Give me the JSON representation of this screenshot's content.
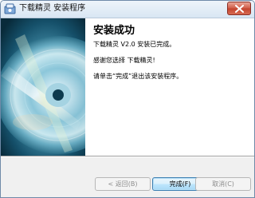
{
  "window": {
    "title": "下载精灵 安装程序",
    "icons": {
      "app": "installer-app-icon",
      "close": "close-icon"
    }
  },
  "main": {
    "heading": "安装成功",
    "lines": [
      "下载精灵 V2.0 安装已完成。",
      "感谢您选择 下载精灵!",
      "请单击“完成”退出该安装程序。"
    ]
  },
  "buttons": {
    "back": {
      "label": "< 返回(B)",
      "enabled": false
    },
    "finish": {
      "label": "完成(F)",
      "enabled": true
    },
    "cancel": {
      "label": "取消(C)",
      "enabled": false
    }
  },
  "colors": {
    "title_gradient_top": "#eef4fa",
    "close_red": "#c2422c",
    "cd_panel_bg": "#0d3a4e"
  }
}
